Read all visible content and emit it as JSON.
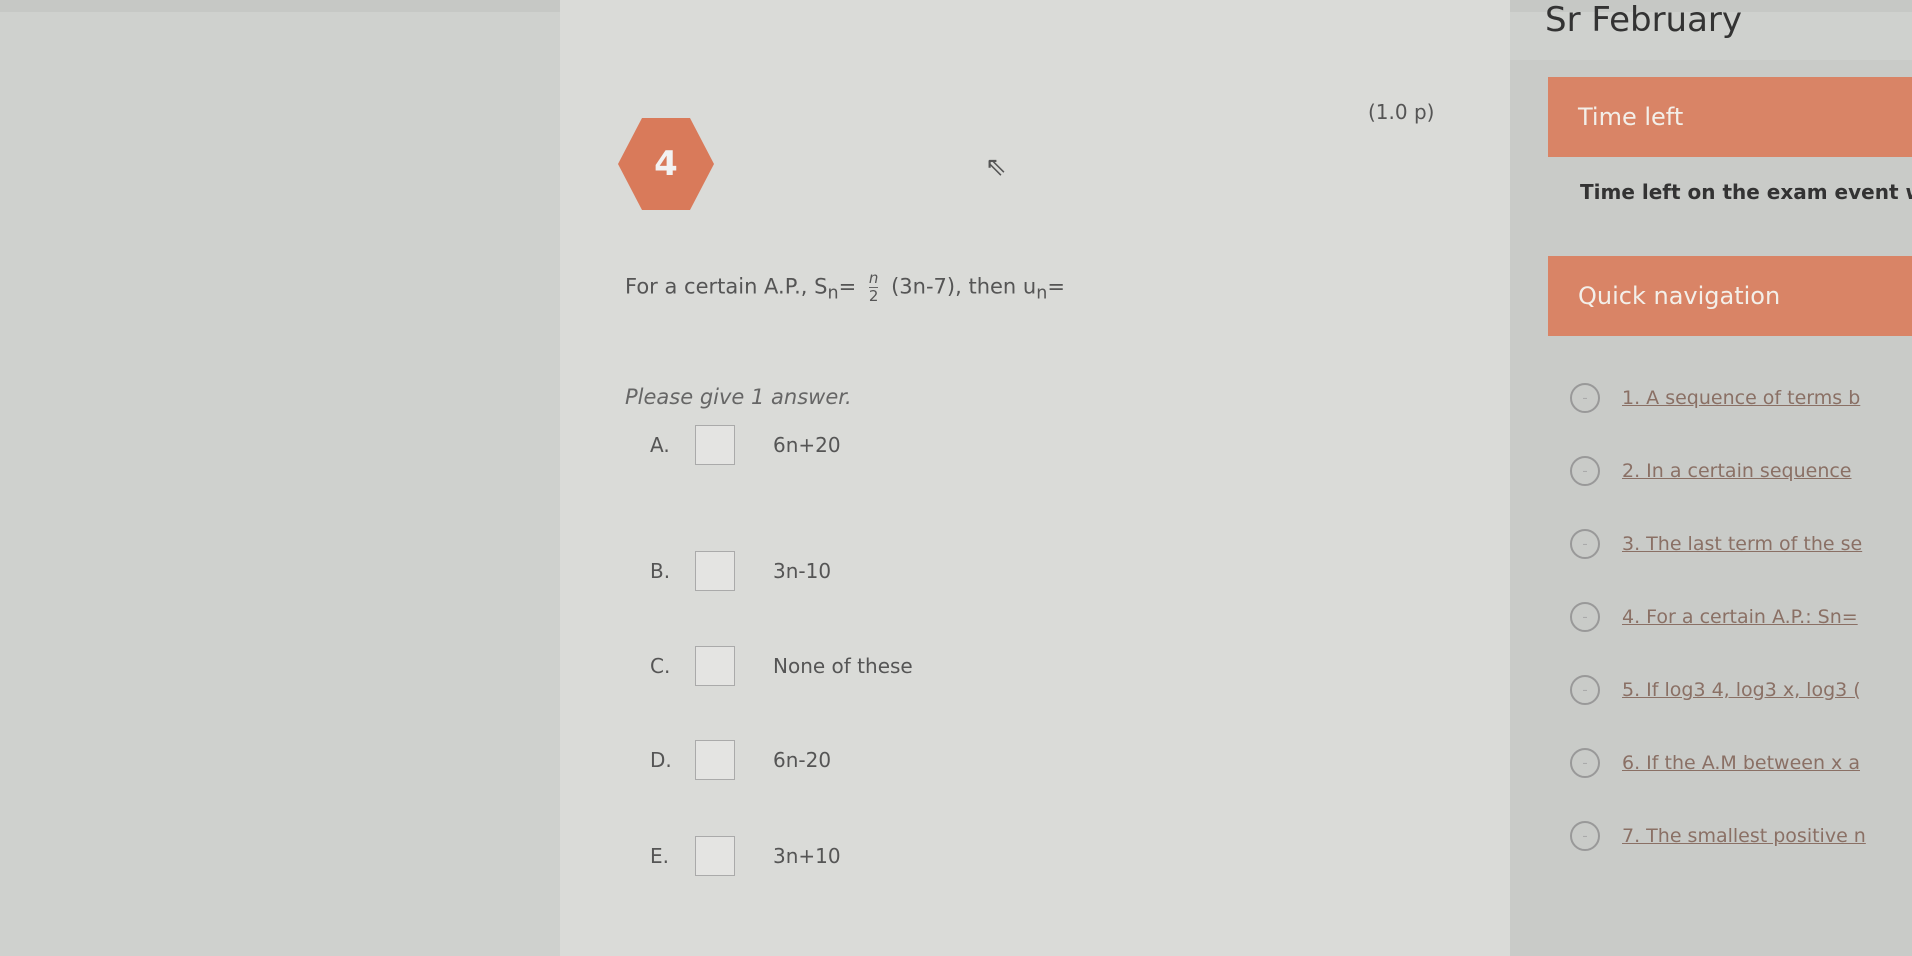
{
  "header": {
    "course": "Sr February"
  },
  "question": {
    "number": "4",
    "points": "(1.0 p)",
    "text_before": "For a certain A.P., S",
    "sub_n": "n",
    "eq": "=",
    "frac_num": "n",
    "frac_den": "2",
    "text_after": "(3n-7), then u",
    "sub_n2": "n",
    "eq2": "=",
    "hint": "Please give 1 answer.",
    "options": [
      {
        "label": "A.",
        "text": "6n+20"
      },
      {
        "label": "B.",
        "text": "3n-10"
      },
      {
        "label": "C.",
        "text": "None of these"
      },
      {
        "label": "D.",
        "text": "6n-20"
      },
      {
        "label": "E.",
        "text": "3n+10"
      }
    ]
  },
  "sidebar": {
    "time_left_title": "Time left",
    "time_left_desc": "Time left on the exam event w",
    "quick_nav_title": "Quick navigation",
    "nav_items": [
      "1. A sequence of terms b",
      "2. In a certain sequence",
      "3. The last term of the se",
      "4. For a certain A.P.: Sn=",
      "5. If log3 4, log3 x, log3 (",
      "6. If the A.M between x a",
      "7. The smallest positive n"
    ]
  },
  "colors": {
    "accent": "#d98466"
  }
}
